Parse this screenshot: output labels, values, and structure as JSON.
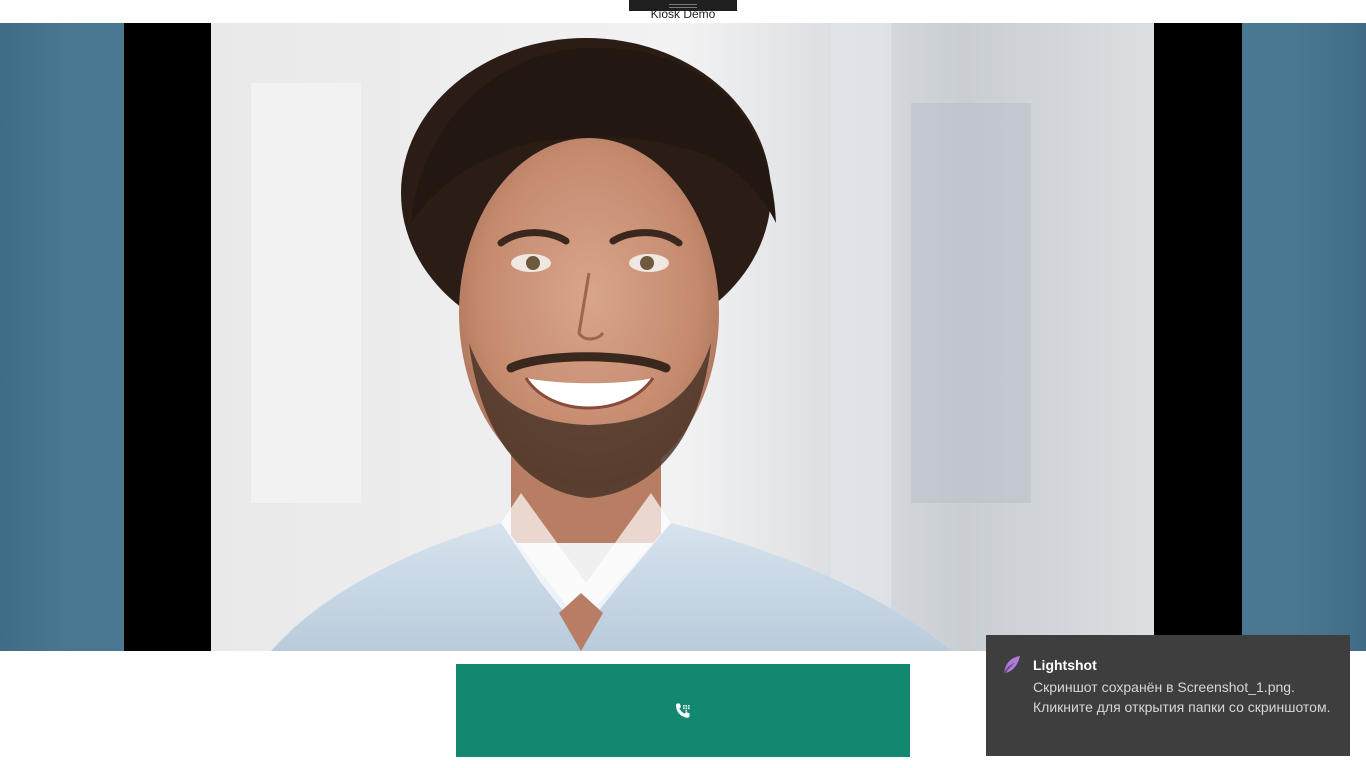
{
  "window": {
    "title": "Kiosk Demo"
  },
  "video": {
    "subject": "smiling man with curly hair in light blue shirt"
  },
  "call_button": {
    "icon": "phone-dial-icon",
    "color": "#138870"
  },
  "notification": {
    "app_name": "Lightshot",
    "icon": "feather-icon",
    "message": "Скриншот сохранён в Screenshot_1.png.\nКликните для открытия папки со скриншотом."
  },
  "colors": {
    "side_panel": "#4d7b95",
    "letterbox": "#000000",
    "toast_bg": "#3e3e3e"
  }
}
